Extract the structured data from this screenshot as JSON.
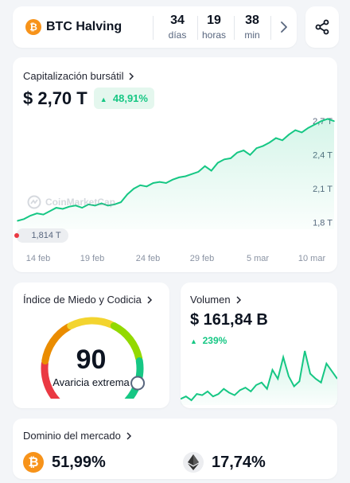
{
  "halving": {
    "title": "BTC Halving",
    "coin_glyph": "₿",
    "countdown": [
      {
        "value": "34",
        "unit": "días"
      },
      {
        "value": "19",
        "unit": "horas"
      },
      {
        "value": "38",
        "unit": "min"
      }
    ]
  },
  "market_cap": {
    "label": "Capitalización bursátil",
    "value": "$ 2,70 T",
    "change": "48,91%",
    "watermark": "CoinMarketCap",
    "start_marker": "1,814 T"
  },
  "chart_data": {
    "type": "area",
    "x_ticks": [
      "14 feb",
      "19 feb",
      "24 feb",
      "29 feb",
      "5 mar",
      "10 mar"
    ],
    "y_ticks": [
      "2,7 T",
      "2,4 T",
      "2,1 T",
      "1,8 T"
    ],
    "y_unit": "T",
    "ylim": [
      1.8,
      2.7
    ],
    "series": [
      {
        "values": [
          1.814,
          1.83,
          1.86,
          1.88,
          1.87,
          1.9,
          1.93,
          1.92,
          1.94,
          1.95,
          1.93,
          1.96,
          1.95,
          1.97,
          1.95,
          1.96,
          1.98,
          2.05,
          2.1,
          2.13,
          2.12,
          2.15,
          2.16,
          2.15,
          2.18,
          2.2,
          2.21,
          2.23,
          2.25,
          2.3,
          2.26,
          2.33,
          2.36,
          2.37,
          2.42,
          2.44,
          2.4,
          2.46,
          2.48,
          2.51,
          2.55,
          2.53,
          2.58,
          2.62,
          2.6,
          2.64,
          2.67,
          2.7,
          2.72,
          2.7
        ]
      }
    ],
    "line_color": "#16c784",
    "grid": false
  },
  "fear_greed": {
    "label": "Índice de Miedo y Codicia",
    "value": "90",
    "value_numeric": 90,
    "status": "Avaricia extrema"
  },
  "volume": {
    "label": "Volumen",
    "value": "$ 161,84 B",
    "change": "239%",
    "sparkline": [
      22,
      24,
      21,
      26,
      25,
      28,
      24,
      26,
      30,
      27,
      25,
      29,
      31,
      28,
      33,
      35,
      30,
      45,
      38,
      55,
      40,
      32,
      36,
      60,
      42,
      38,
      35,
      50,
      44,
      38
    ]
  },
  "dominance": {
    "label": "Dominio del mercado",
    "btc": "51,99%",
    "eth": "17,74%",
    "btc_glyph": "₿"
  },
  "colors": {
    "accent_green": "#16c784",
    "btc_orange": "#f7931a",
    "text": "#0d1421",
    "muted": "#58667e"
  }
}
